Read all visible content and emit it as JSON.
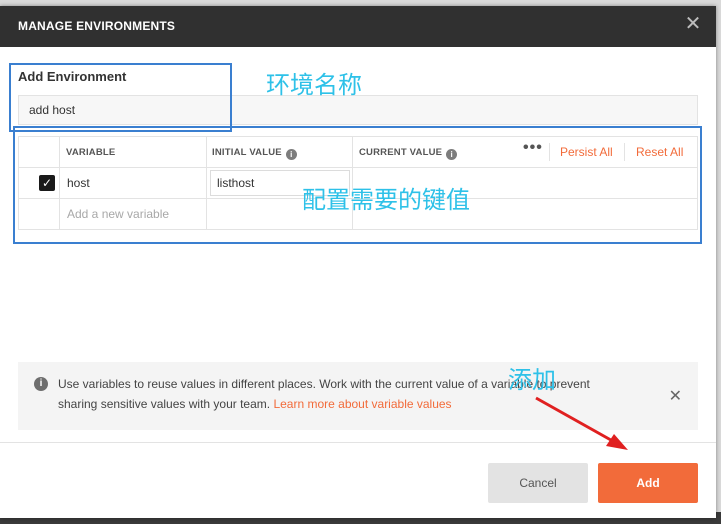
{
  "dialog": {
    "title": "MANAGE ENVIRONMENTS",
    "close_glyph": "✕"
  },
  "environment": {
    "label": "Add Environment",
    "name_value": "add host"
  },
  "table": {
    "headers": {
      "variable": "VARIABLE",
      "initial_value": "INITIAL VALUE",
      "current_value": "CURRENT VALUE"
    },
    "more_glyph": "•••",
    "persist_all": "Persist All",
    "reset_all": "Reset All",
    "rows": [
      {
        "checked": true,
        "check_glyph": "✓",
        "variable": "host",
        "initial_value": "listhost",
        "current_value": ""
      }
    ],
    "new_variable_placeholder": "Add a new variable"
  },
  "notice": {
    "icon_glyph": "i",
    "text": "Use variables to reuse values in different places. Work with the current value of a variable to prevent sharing sensitive values with your team.",
    "link_text": "Learn more about variable values",
    "close_glyph": "✕"
  },
  "footer": {
    "cancel_label": "Cancel",
    "add_label": "Add"
  },
  "annotations": {
    "env_name": "环境名称",
    "key_values": "配置需要的键值",
    "add": "添加",
    "color": "#2ec1e8",
    "box_color": "#3a7fd0",
    "arrow_color": "#e02020"
  },
  "colors": {
    "accent": "#f26b3a",
    "header_bg": "#303030"
  }
}
